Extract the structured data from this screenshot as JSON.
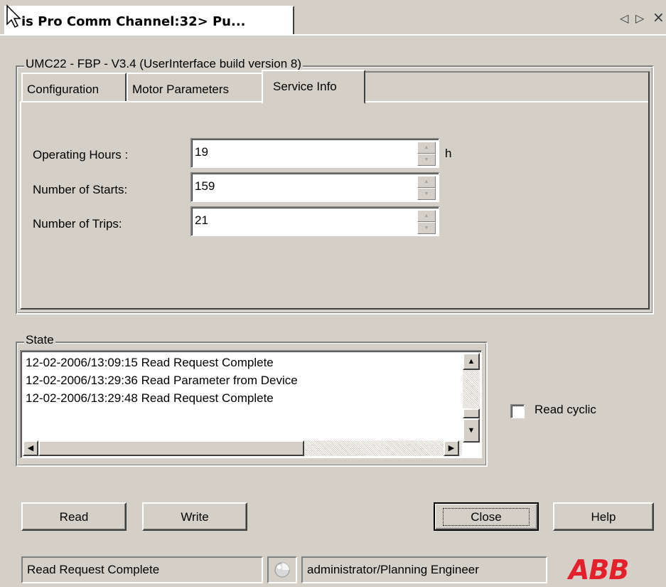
{
  "doc_tab": {
    "title": "is Pro Comm Channel:32> Pu..."
  },
  "nav": {
    "prev": "◁",
    "next": "▷",
    "close": "×"
  },
  "device_group": {
    "legend": "UMC22 - FBP - V3.4 (UserInterface build version 8)"
  },
  "tabs": [
    {
      "label": "Configuration",
      "active": false
    },
    {
      "label": "Motor Parameters",
      "active": false
    },
    {
      "label": "Service Info",
      "active": true
    }
  ],
  "service_info": {
    "operating_hours": {
      "label": "Operating Hours :",
      "value": "19",
      "unit": "h"
    },
    "number_of_starts": {
      "label": "Number of Starts:",
      "value": "159"
    },
    "number_of_trips": {
      "label": "Number of Trips:",
      "value": "21"
    }
  },
  "state_group": {
    "legend": "State",
    "log": [
      "12-02-2006/13:09:15 Read Request Complete",
      "12-02-2006/13:29:36 Read Parameter from Device",
      "12-02-2006/13:29:48 Read Request Complete"
    ]
  },
  "read_cyclic": {
    "label": "Read cyclic",
    "checked": false
  },
  "buttons": {
    "read": "Read",
    "write": "Write",
    "close": "Close",
    "help": "Help"
  },
  "status_bar": {
    "message": "Read Request Complete",
    "user": "administrator/Planning Engineer",
    "logo": "ABB",
    "logo_color": "#e4202c"
  },
  "icons": [
    "cursor-arrow-icon",
    "spin-up-icon",
    "spin-down-icon",
    "scroll-up-icon",
    "scroll-down-icon",
    "scroll-left-icon",
    "scroll-right-icon",
    "connection-status-icon"
  ]
}
